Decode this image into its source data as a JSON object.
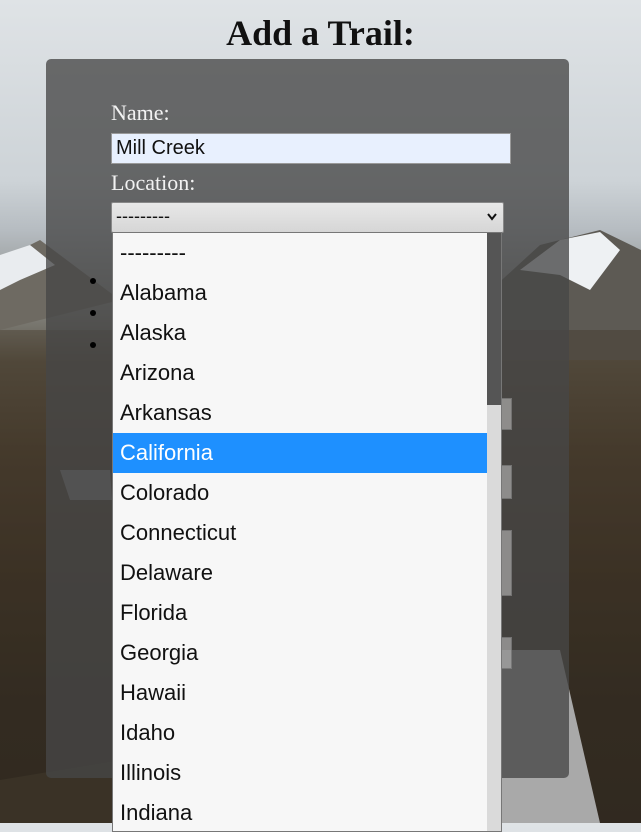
{
  "page": {
    "title": "Add a Trail:"
  },
  "form": {
    "name_label": "Name:",
    "name_value": "Mill Creek",
    "location_label": "Location:",
    "location_selected": "---------"
  },
  "dropdown": {
    "options": [
      "---------",
      "Alabama",
      "Alaska",
      "Arizona",
      "Arkansas",
      "California",
      "Colorado",
      "Connecticut",
      "Delaware",
      "Florida",
      "Georgia",
      "Hawaii",
      "Idaho",
      "Illinois",
      "Indiana"
    ],
    "highlighted": "California",
    "highlight_color": "#1e90ff"
  },
  "icons": {
    "select_arrow": "chevron-down-icon"
  }
}
